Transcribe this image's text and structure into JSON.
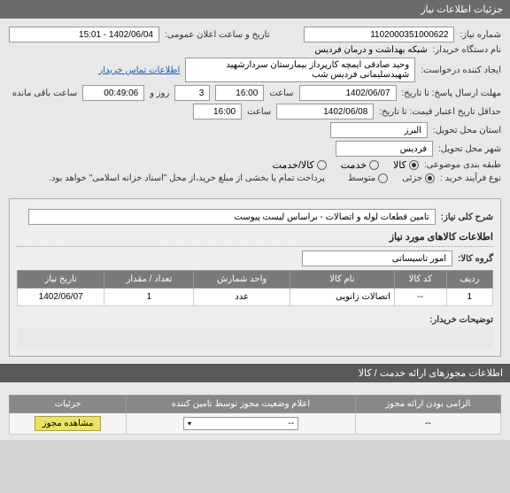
{
  "titleBar": "جزئیات اطلاعات نیاز",
  "rows": {
    "reqNo": {
      "label": "شماره نیاز:",
      "value": "1102000351000622"
    },
    "annDate": {
      "label": "تاریخ و ساعت اعلان عمومی:",
      "value": "1402/06/04 - 15:01"
    },
    "buyerOrg": {
      "label": "نام دستگاه خریدار:",
      "value": "شبکه بهداشت و درمان فردیس"
    },
    "requester": {
      "label": "ایجاد کننده درخواست:",
      "value": "وحید صادقی ایمچه کارپرداز بیمارستان سردارشهید شهیدسلیمانی فردیس شب"
    },
    "contactLink": "اطلاعات تماس خریدار",
    "deadlineResp": {
      "label": "مهلت ارسال پاسخ: تا تاریخ:",
      "date": "1402/06/07",
      "hourLabel": "ساعت",
      "hour": "16:00",
      "daysLabel": "روز و",
      "days": "3",
      "remainLabel": "ساعت باقی مانده",
      "remain": "00:49:06"
    },
    "minCredit": {
      "label": "حداقل تاریخ اعتبار قیمت: تا تاریخ:",
      "date": "1402/06/08",
      "hourLabel": "ساعت",
      "hour": "16:00"
    },
    "province": {
      "label": "استان محل تحویل:",
      "value": "البرز"
    },
    "city": {
      "label": "شهر محل تحویل:",
      "value": "فردیس"
    },
    "subjClass": {
      "label": "طبقه بندی موضوعی:",
      "opts": {
        "goods": "کالا",
        "service": "خدمت",
        "both": "کالا/خدمت"
      },
      "selected": "goods"
    },
    "buyType": {
      "label": "نوع فرآیند خرید :",
      "opts": {
        "partial": "جزئی",
        "medium": "متوسط"
      },
      "selected": "partial",
      "note": "پرداخت تمام یا بخشی از مبلغ خرید،از محل \"اسناد خزانه اسلامی\" خواهد بود."
    }
  },
  "desc": {
    "label": "شرح کلی نیاز:",
    "value": "تامین قطعات لوله و اتصالات - براساس لیست پیوست"
  },
  "goodsHeader": "اطلاعات کالاهای مورد نیاز",
  "goodsGroup": {
    "label": "گروه کالا:",
    "value": "امور تاسیساتی"
  },
  "table": {
    "cols": {
      "row": "ردیف",
      "code": "کد کالا",
      "name": "نام کالا",
      "unit": "واحد شمارش",
      "qty": "تعداد / مقدار",
      "date": "تاریخ نیاز"
    },
    "rows": [
      {
        "row": "1",
        "code": "--",
        "name": "اتصالات زانویی",
        "unit": "عدد",
        "qty": "1",
        "date": "1402/06/07"
      }
    ]
  },
  "buyerNotesLabel": "توضیحات خریدار:",
  "permHeader": "اطلاعات مجوزهای ارائه خدمت / کالا",
  "permTable": {
    "cols": {
      "required": "الزامی بودن ارائه مجوز",
      "status": "اعلام وضعیت مجوز توسط تامین کننده",
      "details": "جزئیات"
    },
    "row": {
      "required": "--",
      "statusPlaceholder": "--",
      "btn": "مشاهده مجوز"
    }
  }
}
